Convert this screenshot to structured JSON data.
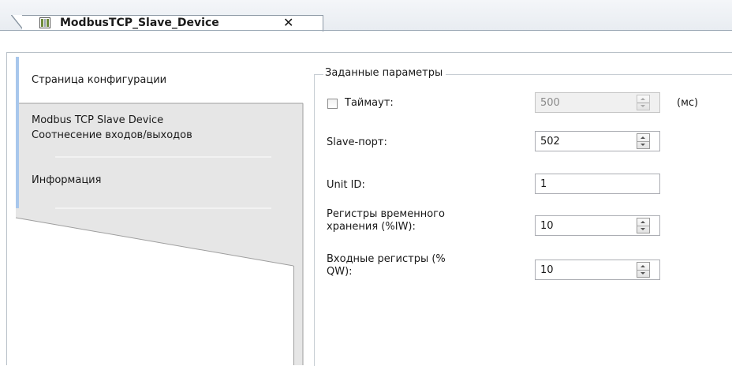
{
  "document_tab": {
    "title": "ModbusTCP_Slave_Device",
    "close_glyph": "✕",
    "icon": "device-icon"
  },
  "nav": {
    "items": [
      {
        "label": "Страница конфигурации",
        "active": true
      },
      {
        "label_line1": "Modbus TCP Slave Device",
        "label_line2": "Соотнесение входов/выходов",
        "active": false
      },
      {
        "label": "Информация",
        "active": false
      }
    ]
  },
  "group": {
    "title": "Заданные параметры",
    "timeout": {
      "label": "Таймаут:",
      "checked": false,
      "value": "500",
      "unit": "(мс)",
      "disabled": true
    },
    "slave_port": {
      "label": "Slave-порт:",
      "value": "502"
    },
    "unit_id": {
      "label": "Unit ID:",
      "value": "1"
    },
    "holding_registers": {
      "label_line1": "Регистры временного",
      "label_line2": "хранения (%IW):",
      "value": "10"
    },
    "input_registers": {
      "label_line1": "Входные регистры (%",
      "label_line2": "QW):",
      "value": "10"
    }
  },
  "colors": {
    "accent": "#a8c7ec",
    "tab_bg": "#e8e8e8",
    "border": "#8e8e8e"
  }
}
